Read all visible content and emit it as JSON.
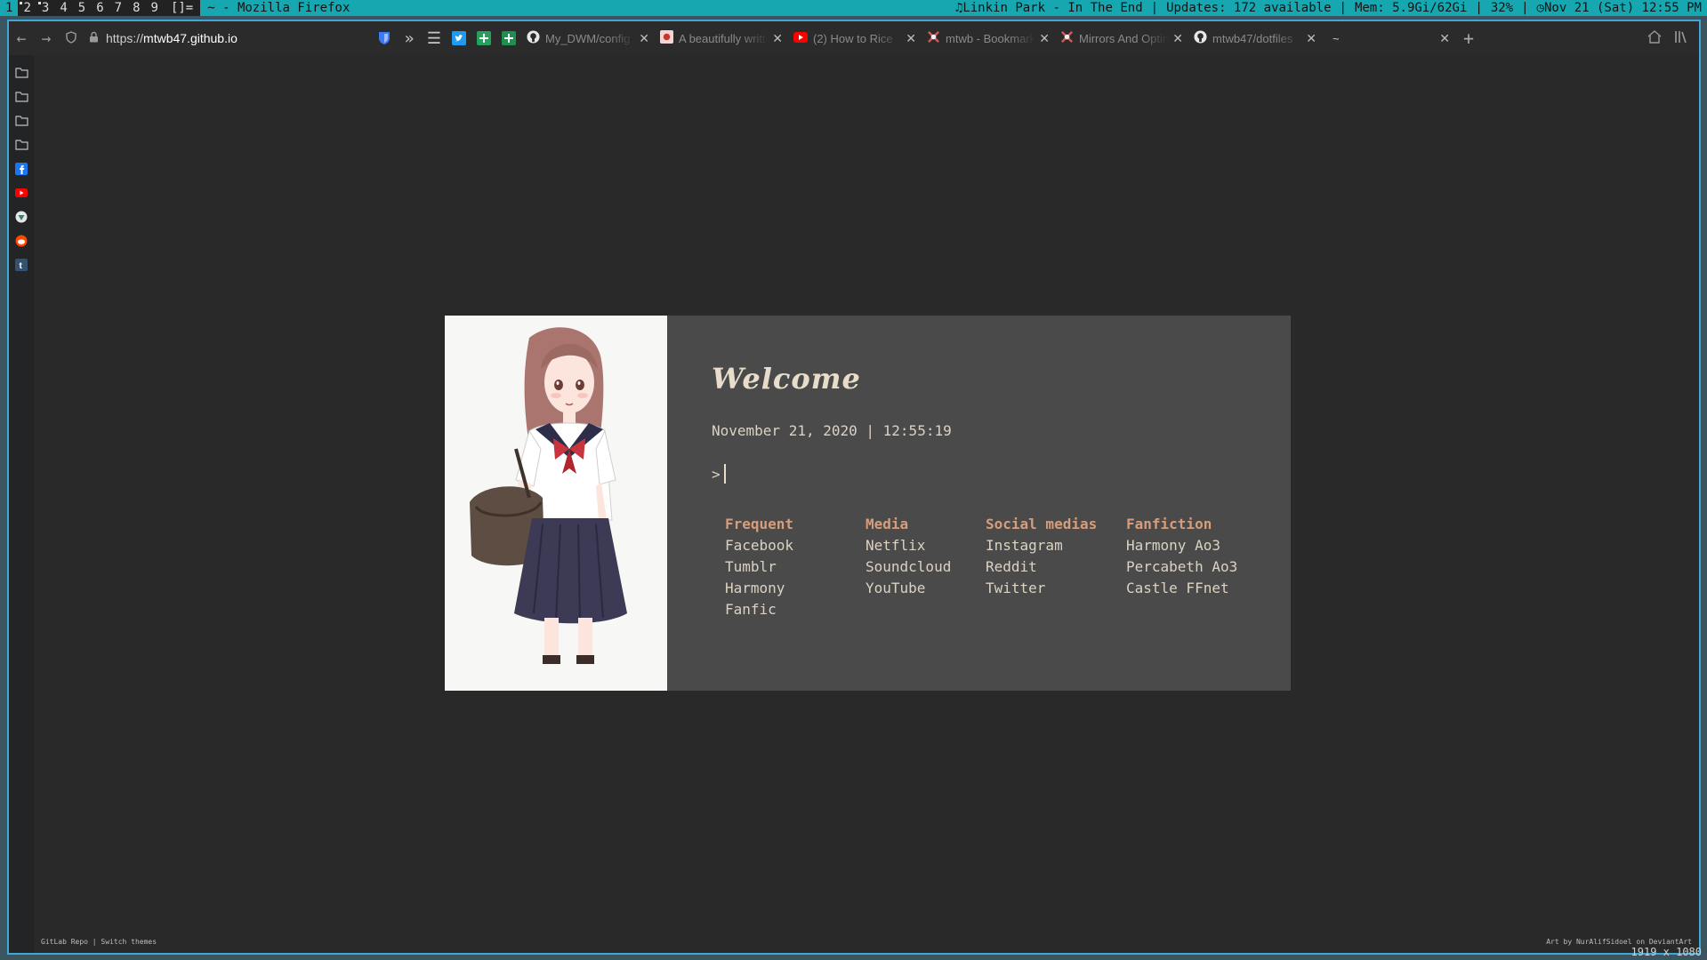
{
  "statusbar": {
    "tags": [
      "1",
      "2",
      "3",
      "4",
      "5",
      "6",
      "7",
      "8",
      "9"
    ],
    "layout": "[]=",
    "window_title": "~ - Mozilla Firefox",
    "music": "Linkin Park - In The End",
    "updates": "Updates: 172 available",
    "mem": "Mem: 5.9Gi/62Gi",
    "cpu": "32%",
    "clock": "Nov 21 (Sat) 12:55 PM"
  },
  "browser": {
    "url_prefix": "https://",
    "url_host": "mtwb47.github.io",
    "tabs": [
      {
        "title": "My_DWM/config",
        "icon": "github-icon"
      },
      {
        "title": "A beautifully written",
        "icon": "image-icon"
      },
      {
        "title": "(2) How to Rice",
        "icon": "youtube-icon"
      },
      {
        "title": "mtwb - Bookmarks",
        "icon": "mtwb-icon"
      },
      {
        "title": "Mirrors And Optimization",
        "icon": "mtwb-icon"
      },
      {
        "title": "mtwb47/dotfiles",
        "icon": "github-icon"
      },
      {
        "title": "~",
        "icon": ""
      }
    ]
  },
  "startpage": {
    "heading": "Welcome",
    "datetime": "November 21, 2020 | 12:55:19",
    "prompt": ">",
    "columns": [
      {
        "head": "Frequent",
        "links": [
          "Facebook",
          "Tumblr",
          "Harmony Fanfic"
        ]
      },
      {
        "head": "Media",
        "links": [
          "Netflix",
          "Soundcloud",
          "YouTube"
        ]
      },
      {
        "head": "Social medias",
        "links": [
          "Instagram",
          "Reddit",
          "Twitter"
        ]
      },
      {
        "head": "Fanfiction",
        "links": [
          "Harmony Ao3",
          "Percabeth Ao3",
          "Castle FFnet"
        ]
      }
    ],
    "footer_left": "GitLab Repo | Switch themes",
    "footer_right": "Art by NurAlifSidoel on DeviantArt"
  },
  "resolution_label": "1919 x 1080",
  "colors": {
    "accent": "#17a7b0",
    "card_bg": "#4a4a4a",
    "head_color": "#d69d7c"
  }
}
